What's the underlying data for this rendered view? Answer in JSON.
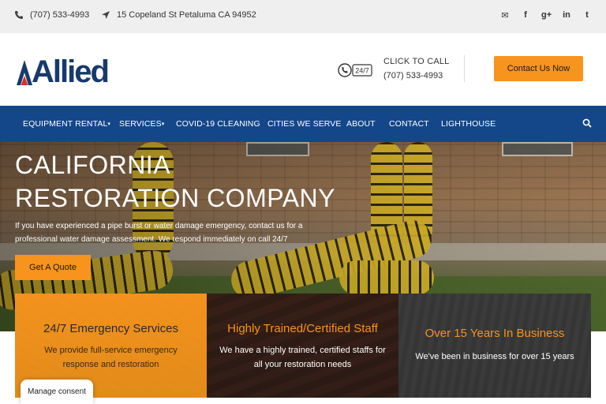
{
  "topbar": {
    "phone": "(707) 533-4993",
    "address": "15 Copeland St Petaluma CA 94952",
    "socials": [
      {
        "icon": "envelope-icon",
        "glyph": "✉"
      },
      {
        "icon": "facebook-icon",
        "glyph": "f"
      },
      {
        "icon": "google-plus-icon",
        "glyph": "g+"
      },
      {
        "icon": "linkedin-icon",
        "glyph": "in"
      },
      {
        "icon": "twitter-icon",
        "glyph": "t"
      }
    ]
  },
  "header": {
    "logo_text": "Allied",
    "call_badge": "24/7",
    "call_label": "CLICK TO CALL",
    "call_number": "(707) 533-4993",
    "contact_button": "Contact Us Now"
  },
  "nav": {
    "items": [
      {
        "label": "EQUIPMENT RENTAL",
        "dropdown": true
      },
      {
        "label": "SERVICES",
        "dropdown": true
      },
      {
        "label": "COVID-19 CLEANING",
        "dropdown": false
      },
      {
        "label": "CITIES WE SERVE",
        "dropdown": false
      },
      {
        "label": "ABOUT",
        "dropdown": false
      },
      {
        "label": "CONTACT",
        "dropdown": false
      },
      {
        "label": "LIGHTHOUSE",
        "dropdown": false
      }
    ]
  },
  "hero": {
    "title_line1": "CALIFORNIA",
    "title_line2": "RESTORATION COMPANY",
    "text": "If you have experienced a pipe burst or water damage emergency, contact us for a professional water damage assessment. We respond immediately on call 24/7",
    "button": "Get A Quote"
  },
  "features": [
    {
      "title": "24/7 Emergency Services",
      "text": "We provide full-service emergency response and restoration"
    },
    {
      "title": "Highly Trained/Certified Staff",
      "text": "We have a highly trained, certified staffs for all your restoration needs"
    },
    {
      "title": "Over 15 Years In Business",
      "text": "We've been in business for over 15 years"
    }
  ],
  "consent": "Manage consent",
  "colors": {
    "accent": "#f7941d",
    "nav": "#14478a",
    "brand": "#173a6b",
    "logo_red": "#d8312b"
  }
}
